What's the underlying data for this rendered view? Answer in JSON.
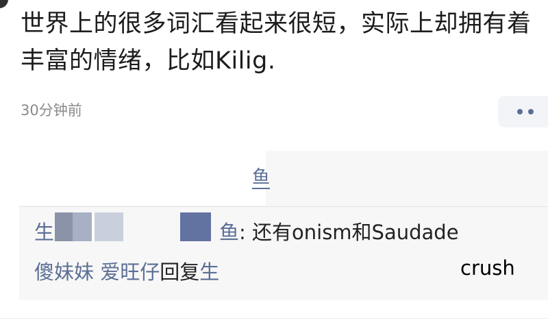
{
  "post": {
    "text": "世界上的很多词汇看起来很短，实际上却拥有着丰富的情绪，比如Kilig.",
    "time": "30分钟前"
  },
  "likes": {
    "visible_name_fragment": "鱼"
  },
  "comments": [
    {
      "author": "生",
      "author_tail": "鱼",
      "sep": ": ",
      "text": "还有onism和Saudade"
    },
    {
      "author": "傻妹妹 爱旺仔",
      "reply_word": "回复",
      "reply_to": "生",
      "text": "crush"
    }
  ],
  "colors": {
    "link": "#5b6f95",
    "text": "#222222",
    "meta": "#8a8a8a",
    "box": "#f7f7f7"
  }
}
